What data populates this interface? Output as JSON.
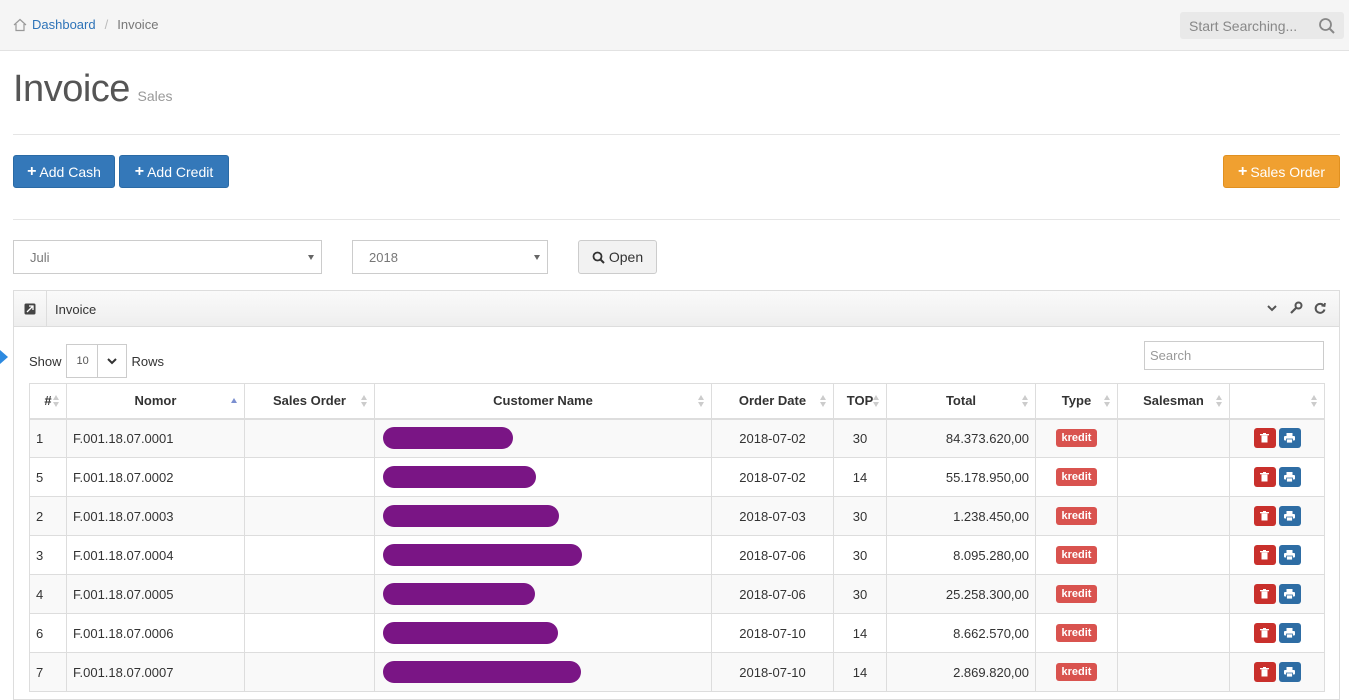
{
  "breadcrumb": {
    "home_label": "Dashboard",
    "current": "Invoice"
  },
  "top_search": {
    "placeholder": "Start Searching..."
  },
  "page": {
    "title": "Invoice",
    "subtitle": "Sales"
  },
  "buttons": {
    "add_cash": "Add Cash",
    "add_credit": "Add Credit",
    "sales_order": "Sales Order",
    "open": "Open"
  },
  "filters": {
    "month": "Juli",
    "year": "2018"
  },
  "panel": {
    "title": "Invoice"
  },
  "table_controls": {
    "show_label": "Show",
    "rows_label": "Rows",
    "page_length": "10",
    "search_placeholder": "Search"
  },
  "columns": [
    "#",
    "Nomor",
    "Sales Order",
    "Customer Name",
    "Order Date",
    "TOP",
    "Total",
    "Type",
    "Salesman",
    ""
  ],
  "rows": [
    {
      "no": "1",
      "nomor": "F.001.18.07.0001",
      "sales_order": "",
      "customer": "",
      "date": "2018-07-02",
      "top": "30",
      "total": "84.373.620,00",
      "type": "kredit",
      "salesman": ""
    },
    {
      "no": "5",
      "nomor": "F.001.18.07.0002",
      "sales_order": "",
      "customer": "",
      "date": "2018-07-02",
      "top": "14",
      "total": "55.178.950,00",
      "type": "kredit",
      "salesman": ""
    },
    {
      "no": "2",
      "nomor": "F.001.18.07.0003",
      "sales_order": "",
      "customer": "",
      "date": "2018-07-03",
      "top": "30",
      "total": "1.238.450,00",
      "type": "kredit",
      "salesman": ""
    },
    {
      "no": "3",
      "nomor": "F.001.18.07.0004",
      "sales_order": "",
      "customer": "",
      "date": "2018-07-06",
      "top": "30",
      "total": "8.095.280,00",
      "type": "kredit",
      "salesman": ""
    },
    {
      "no": "4",
      "nomor": "F.001.18.07.0005",
      "sales_order": "",
      "customer": "",
      "date": "2018-07-06",
      "top": "30",
      "total": "25.258.300,00",
      "type": "kredit",
      "salesman": ""
    },
    {
      "no": "6",
      "nomor": "F.001.18.07.0006",
      "sales_order": "",
      "customer": "",
      "date": "2018-07-10",
      "top": "14",
      "total": "8.662.570,00",
      "type": "kredit",
      "salesman": ""
    },
    {
      "no": "7",
      "nomor": "F.001.18.07.0007",
      "sales_order": "",
      "customer": "",
      "date": "2018-07-10",
      "top": "14",
      "total": "2.869.820,00",
      "type": "kredit",
      "salesman": ""
    }
  ],
  "colors": {
    "primary": "#3478b9",
    "warning": "#f0a030",
    "danger": "#d9534f",
    "redaction": "#7a1585"
  }
}
